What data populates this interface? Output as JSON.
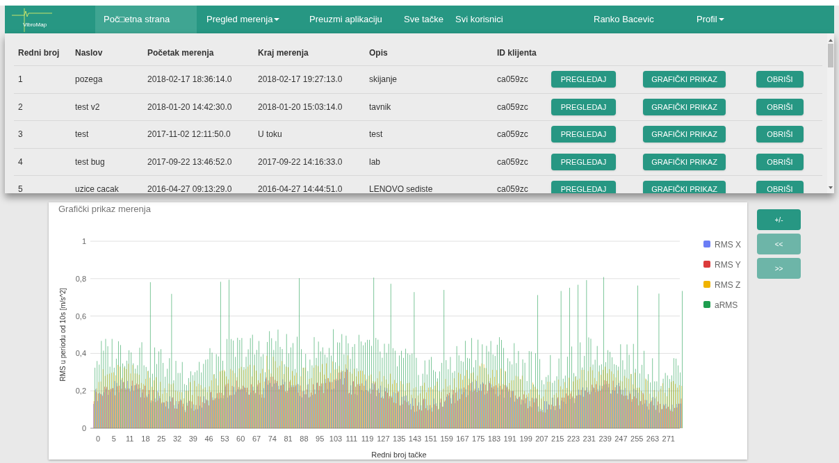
{
  "navbar": {
    "logo": "VibroMap",
    "items": [
      {
        "label": "Poč□etna strana",
        "selected": true,
        "has_menu": false
      },
      {
        "label": "Pregled merenja",
        "selected": false,
        "has_menu": true
      },
      {
        "label": "Preuzmi aplikaciju",
        "selected": false,
        "has_menu": false
      },
      {
        "label": "Sve tačke",
        "selected": false,
        "has_menu": false
      },
      {
        "label": "Svi korisnici",
        "selected": false,
        "has_menu": false
      }
    ],
    "user": "Ranko Bacevic",
    "profile": {
      "label": "Profil",
      "has_menu": true
    }
  },
  "table": {
    "columns": [
      "Redni broj",
      "Naslov",
      "Početak merenja",
      "Kraj merenja",
      "Opis",
      "ID klijenta"
    ],
    "rows": [
      {
        "cells": [
          "1",
          "pozega",
          "2018-02-17 18:36:14.0",
          "2018-02-17 19:27:13.0",
          "skijanje",
          "ca059zc"
        ],
        "actions": [
          "PREGLEDAJ",
          "GRAFIČKI PRIKAZ",
          "OBRIŠI"
        ]
      },
      {
        "cells": [
          "2",
          "test v2",
          "2018-01-20 14:42:30.0",
          "2018-01-20 15:03:14.0",
          "tavnik",
          "ca059zc"
        ],
        "actions": [
          "PREGLEDAJ",
          "GRAFIČKI PRIKAZ",
          "OBRIŠI"
        ]
      },
      {
        "cells": [
          "3",
          "test",
          "2017-11-02 12:11:50.0",
          "U toku",
          "test",
          "ca059zc"
        ],
        "actions": [
          "PREGLEDAJ",
          "GRAFIČKI PRIKAZ",
          "OBRIŠI"
        ]
      },
      {
        "cells": [
          "4",
          "test bug",
          "2017-09-22 13:46:52.0",
          "2017-09-22 14:16:33.0",
          "lab",
          "ca059zc"
        ],
        "actions": [
          "PREGLEDAJ",
          "GRAFIČKI PRIKAZ",
          "OBRIŠI"
        ]
      },
      {
        "cells": [
          "5",
          "uzice cacak",
          "2016-04-27 09:13:29.0",
          "2016-04-27 14:44:51.0",
          "LENOVO sediste",
          "ca059zc"
        ],
        "actions": [
          "PREGLEDAJ",
          "GRAFIČKI PRIKAZ",
          "OBRIŠI"
        ]
      }
    ]
  },
  "chart": {
    "title": "Grafički prikaz merenja",
    "xlabel": "Redni broj tačke",
    "ylabel": "RMS u periodu od 10s [m/s^2]",
    "y_axis_labels": [
      "1",
      "0,8",
      "0,6",
      "0,4",
      "0,2",
      "0"
    ],
    "x_axis_labels": [
      "0",
      "5",
      "11",
      "18",
      "25",
      "32",
      "39",
      "46",
      "53",
      "60",
      "67",
      "74",
      "81",
      "88",
      "95",
      "103",
      "111",
      "119",
      "127",
      "135",
      "143",
      "151",
      "159",
      "167",
      "175",
      "183",
      "191",
      "199",
      "207",
      "215",
      "223",
      "231",
      "239",
      "247",
      "255",
      "263",
      "271"
    ],
    "legend": [
      {
        "name": "RMS X",
        "color": "#6b7ef5"
      },
      {
        "name": "RMS Y",
        "color": "#dc3b3b"
      },
      {
        "name": "RMS Z",
        "color": "#f0b400"
      },
      {
        "name": "aRMS",
        "color": "#1e9e4f"
      }
    ]
  },
  "side_buttons": [
    {
      "label": "+/-",
      "disabled": false
    },
    {
      "label": "<<",
      "disabled": true
    },
    {
      "label": ">>",
      "disabled": true
    }
  ]
}
